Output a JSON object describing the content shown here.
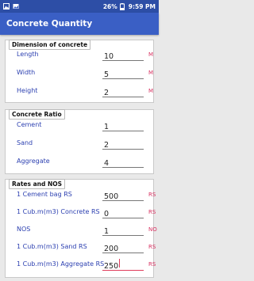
{
  "status": {
    "battery": "26%",
    "time": "9:59 PM"
  },
  "app": {
    "title": "Concrete Quantity"
  },
  "dimension": {
    "title": "Dimension of concrete",
    "rows": [
      {
        "label": "Length",
        "value": "10",
        "unit": "M"
      },
      {
        "label": "Width",
        "value": "5",
        "unit": "M"
      },
      {
        "label": "Height",
        "value": "2",
        "unit": "M"
      }
    ]
  },
  "ratio": {
    "title": "Concrete Ratio",
    "rows": [
      {
        "label": "Cement",
        "value": "1",
        "unit": ""
      },
      {
        "label": "Sand",
        "value": "2",
        "unit": ""
      },
      {
        "label": "Aggregate",
        "value": "4",
        "unit": ""
      }
    ]
  },
  "rates": {
    "title": "Rates and NOS",
    "rows": [
      {
        "label": "1 Cement bag RS",
        "value": "500",
        "unit": "RS"
      },
      {
        "label": "1 Cub.m(m3) Concrete RS",
        "value": "0",
        "unit": "RS"
      },
      {
        "label": "NOS",
        "value": "1",
        "unit": "NO"
      },
      {
        "label": "1 Cub.m(m3) Sand RS",
        "value": "200",
        "unit": "RS"
      },
      {
        "label": "1 Cub.m(m3) Aggregate RS",
        "value": "250",
        "unit": "RS"
      }
    ]
  },
  "colors": {
    "status_bar": "#2d4ea6",
    "app_bar": "#3a5fc5",
    "label": "#2b3fb0",
    "unit": "#d83060",
    "focus_underline": "#e03a5a"
  },
  "icons": {
    "status_left": [
      "gallery-icon",
      "image-icon"
    ],
    "status_right": [
      "battery-icon"
    ]
  }
}
